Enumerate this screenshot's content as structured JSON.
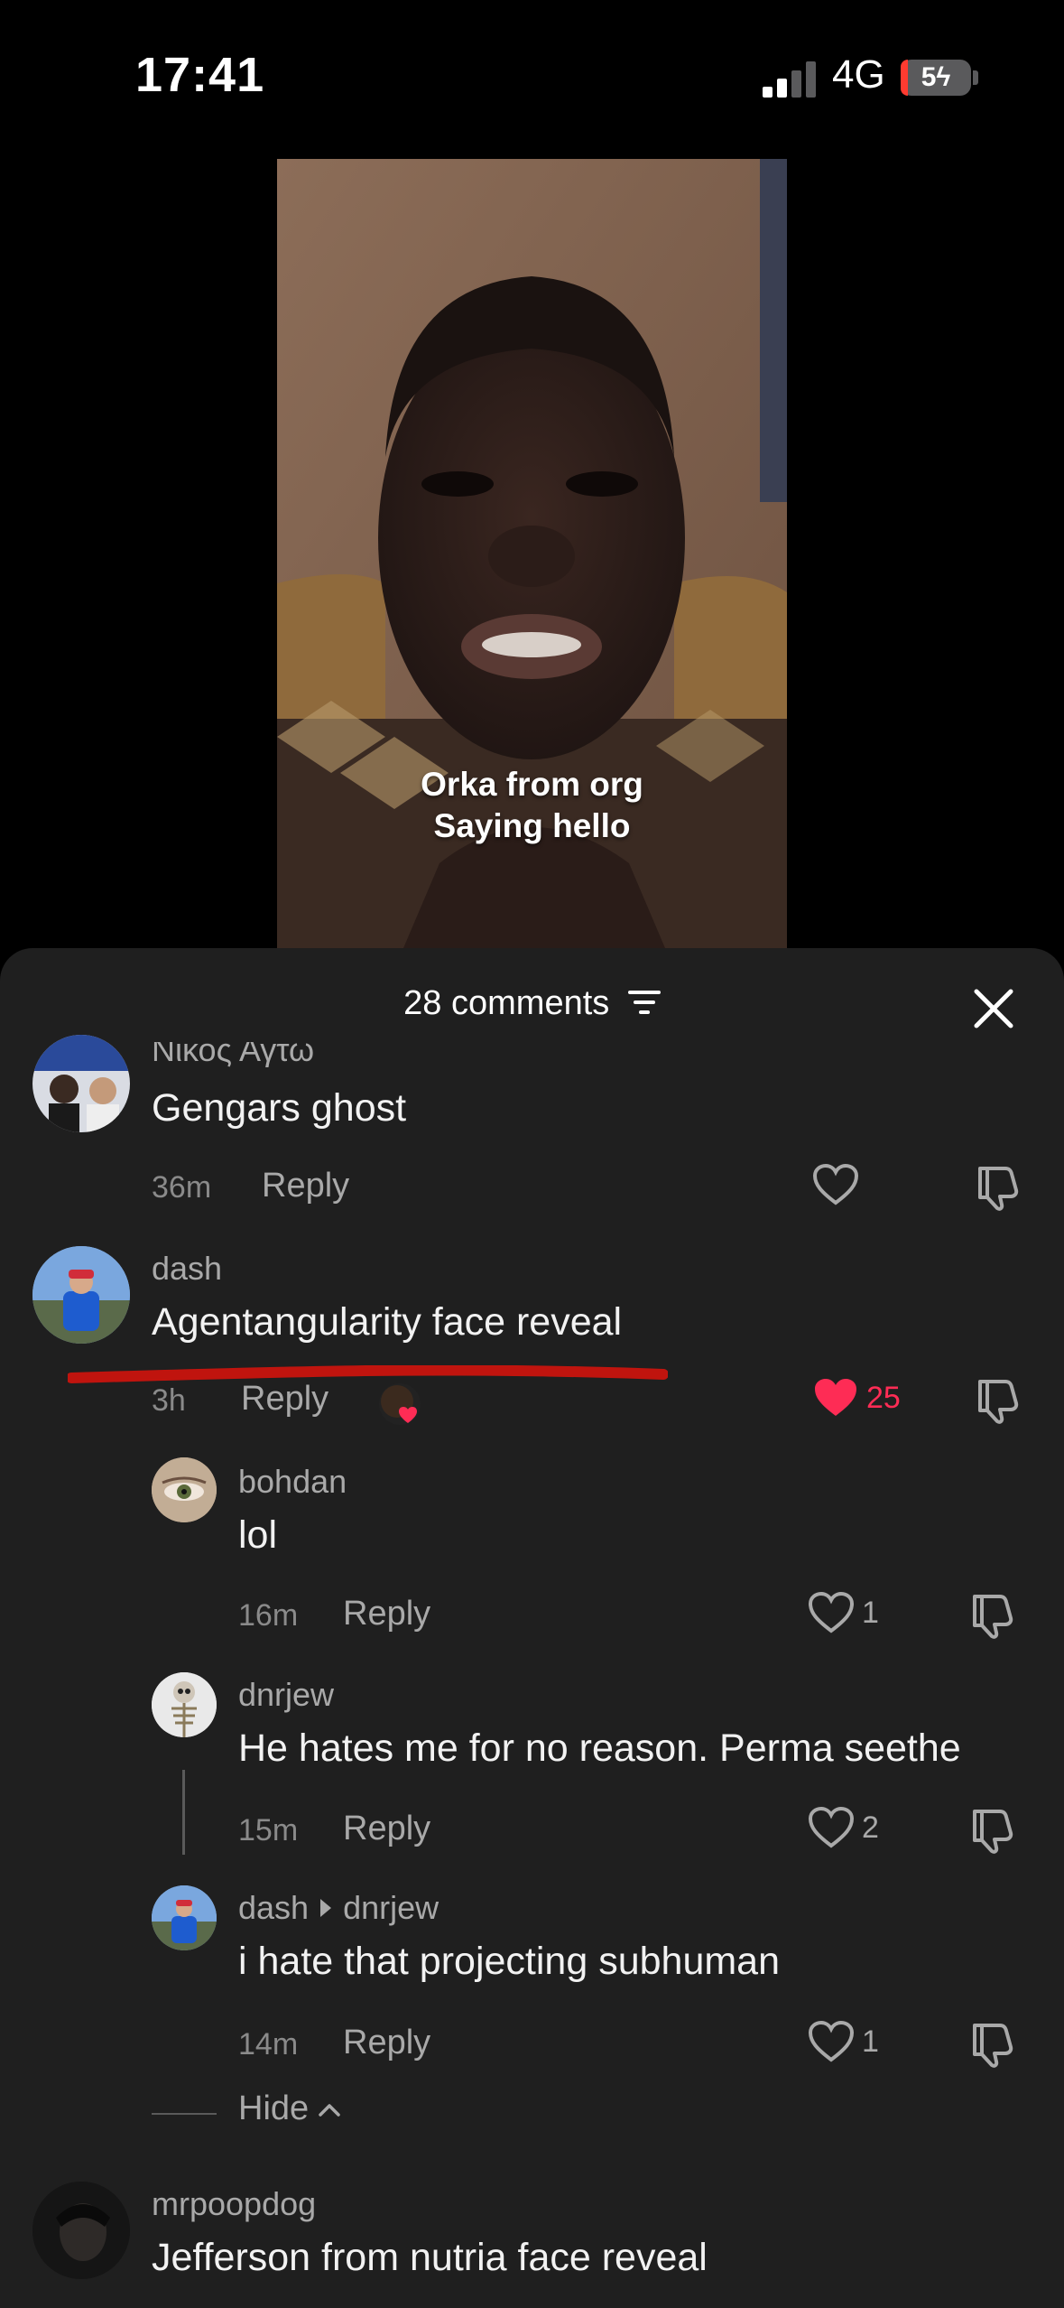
{
  "status_bar": {
    "time": "17:41",
    "network": "4G",
    "battery": "5"
  },
  "video": {
    "caption_line1": "Orka from org",
    "caption_line2": "Saying hello"
  },
  "comments_panel": {
    "count_label": "28 comments"
  },
  "comments": [
    {
      "author": "Νίκος Αγτω",
      "text": "Gengars ghost",
      "time": "36m",
      "reply_label": "Reply",
      "likes": ""
    },
    {
      "author": "dash",
      "text": "Agentangularity face reveal",
      "time": "3h",
      "reply_label": "Reply",
      "likes": "25",
      "liked": true
    },
    {
      "author": "bohdan",
      "text": "lol",
      "time": "16m",
      "reply_label": "Reply",
      "likes": "1"
    },
    {
      "author": "dnrjew",
      "text": "He hates me for no reason. Perma seethe",
      "time": "15m",
      "reply_label": "Reply",
      "likes": "2"
    },
    {
      "author": "dash",
      "reply_to": "dnrjew",
      "text": "i hate that projecting subhuman",
      "time": "14m",
      "reply_label": "Reply",
      "likes": "1"
    },
    {
      "author": "mrpoopdog",
      "text": "Jefferson from nutria face reveal"
    }
  ],
  "hide_label": "Hide",
  "colors": {
    "accent_like": "#fe2c55",
    "background_sheet": "#1f1f1f",
    "annotation_red": "#c0140e"
  }
}
